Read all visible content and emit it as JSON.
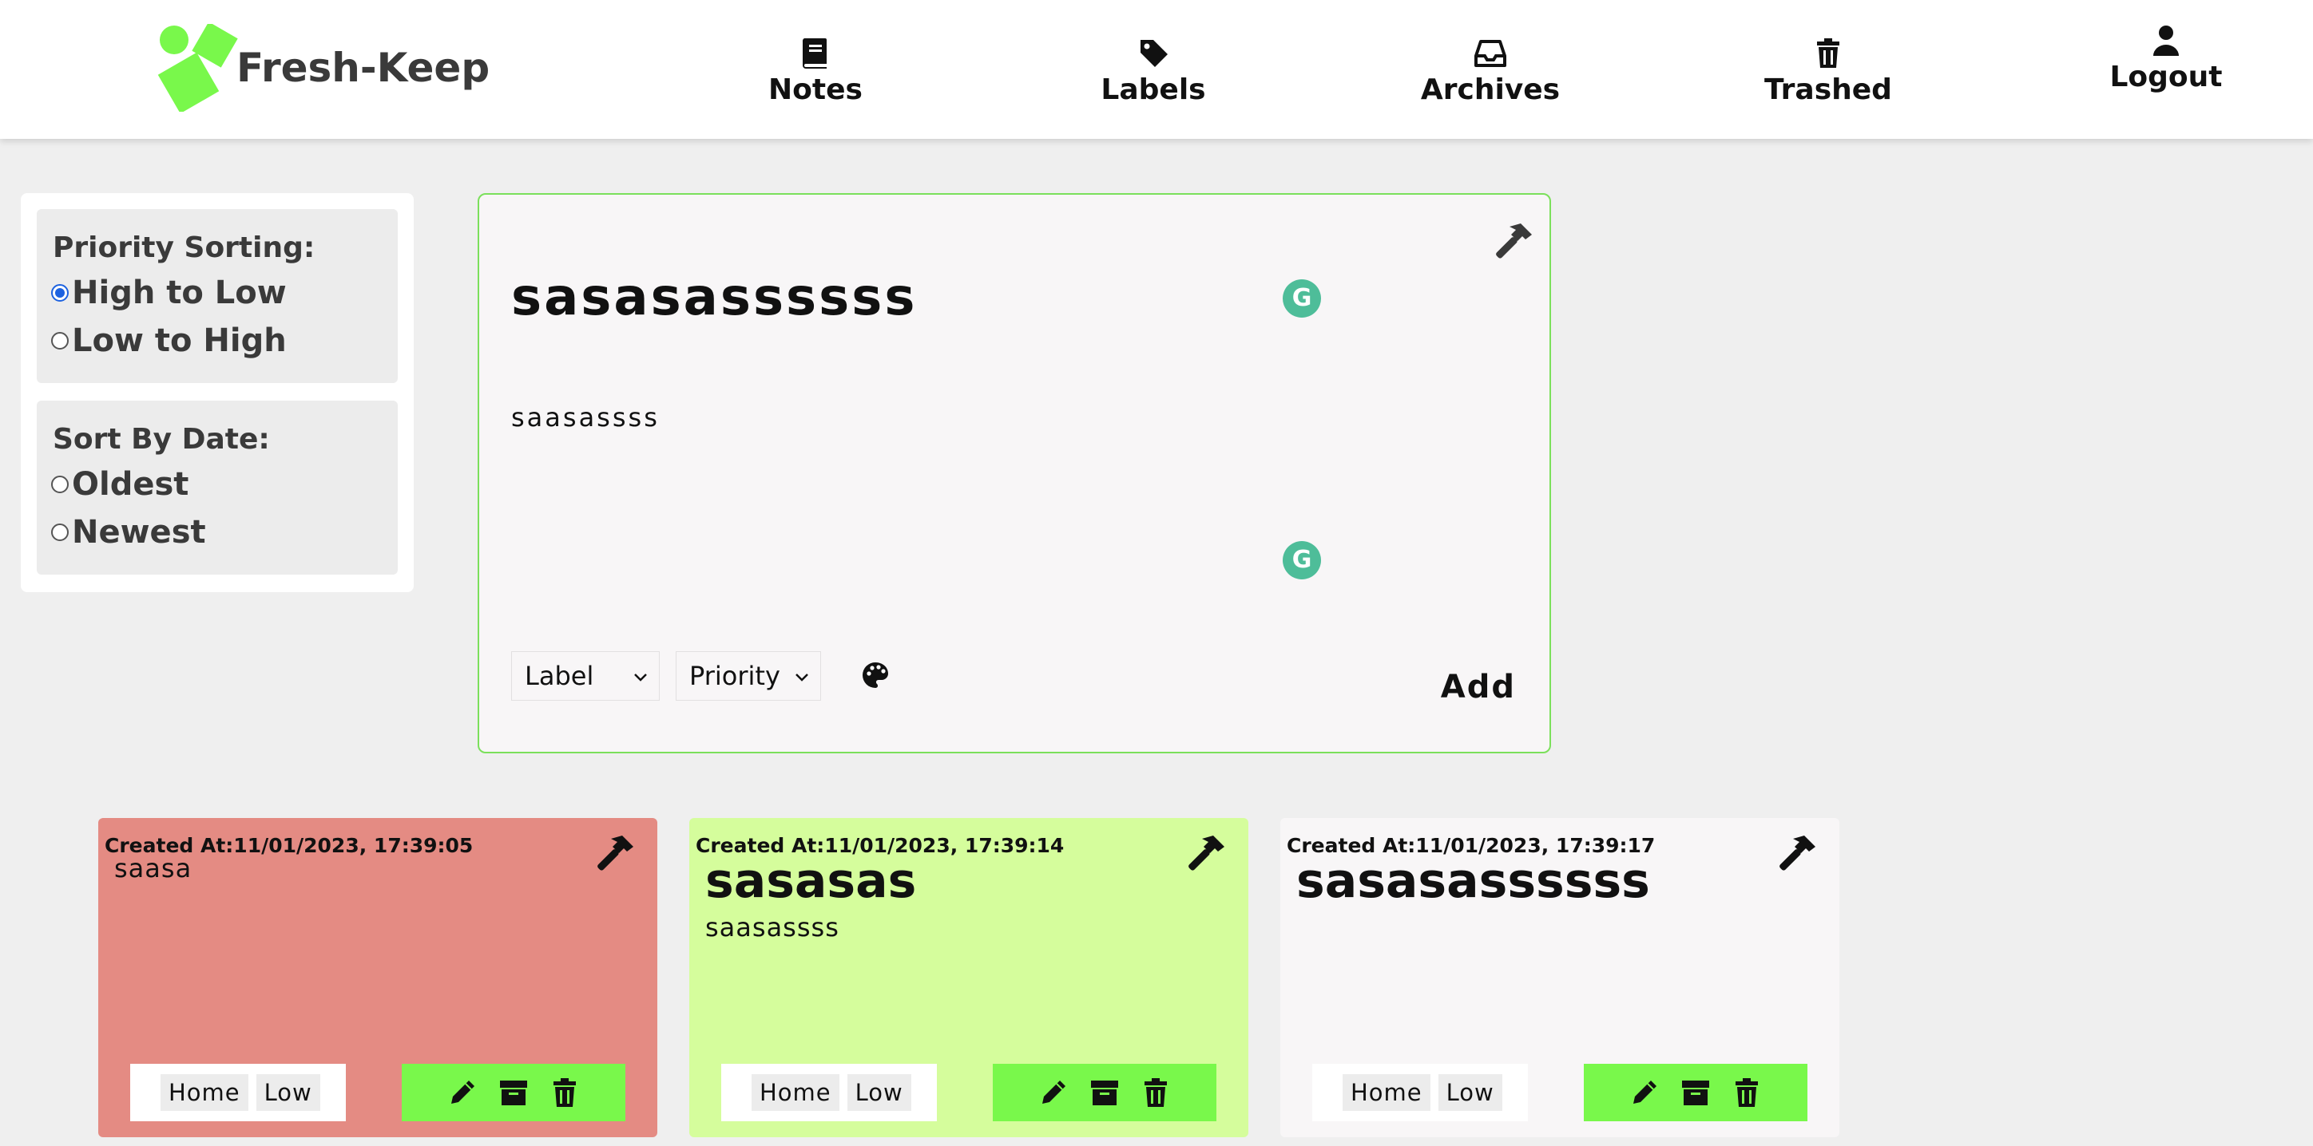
{
  "colors": {
    "brand": "#79f84b",
    "accent_border": "#7be05b",
    "grammarly": "#4ebd99",
    "card_red": "#e48b83",
    "card_green": "#d5fd9c",
    "card_white": "#f8f6f7"
  },
  "brand": {
    "name": "Fresh-Keep",
    "logo_icon": "diamond-logo-icon"
  },
  "nav": {
    "notes": {
      "label": "Notes",
      "icon": "book-icon"
    },
    "labels": {
      "label": "Labels",
      "icon": "tag-icon"
    },
    "archives": {
      "label": "Archives",
      "icon": "inbox-icon"
    },
    "trashed": {
      "label": "Trashed",
      "icon": "trash-icon"
    },
    "logout": {
      "label": "Logout",
      "icon": "user-icon"
    }
  },
  "sidebar": {
    "priority": {
      "title": "Priority Sorting:",
      "options": [
        {
          "label": "High to Low",
          "checked": true
        },
        {
          "label": "Low to High",
          "checked": false
        }
      ]
    },
    "date": {
      "title": "Sort By Date:",
      "options": [
        {
          "label": "Oldest",
          "checked": false
        },
        {
          "label": "Newest",
          "checked": false
        }
      ]
    }
  },
  "editor": {
    "title": "sasasassssss",
    "body": "saasassss",
    "label_select": "Label",
    "priority_select": "Priority",
    "add_label": "Add",
    "grammarly_badge": "G"
  },
  "notes": [
    {
      "created": "Created At:11/01/2023, 17:39:05",
      "title": "saasa",
      "body": "",
      "tags": [
        "Home",
        "Low"
      ],
      "color": "#e48b83"
    },
    {
      "created": "Created At:11/01/2023, 17:39:14",
      "title": "sasasas",
      "body": "saasassss",
      "tags": [
        "Home",
        "Low"
      ],
      "color": "#d5fd9c"
    },
    {
      "created": "Created At:11/01/2023, 17:39:17",
      "title": "sasasassssss",
      "body": "",
      "tags": [
        "Home",
        "Low"
      ],
      "color": "#f8f6f7"
    }
  ]
}
